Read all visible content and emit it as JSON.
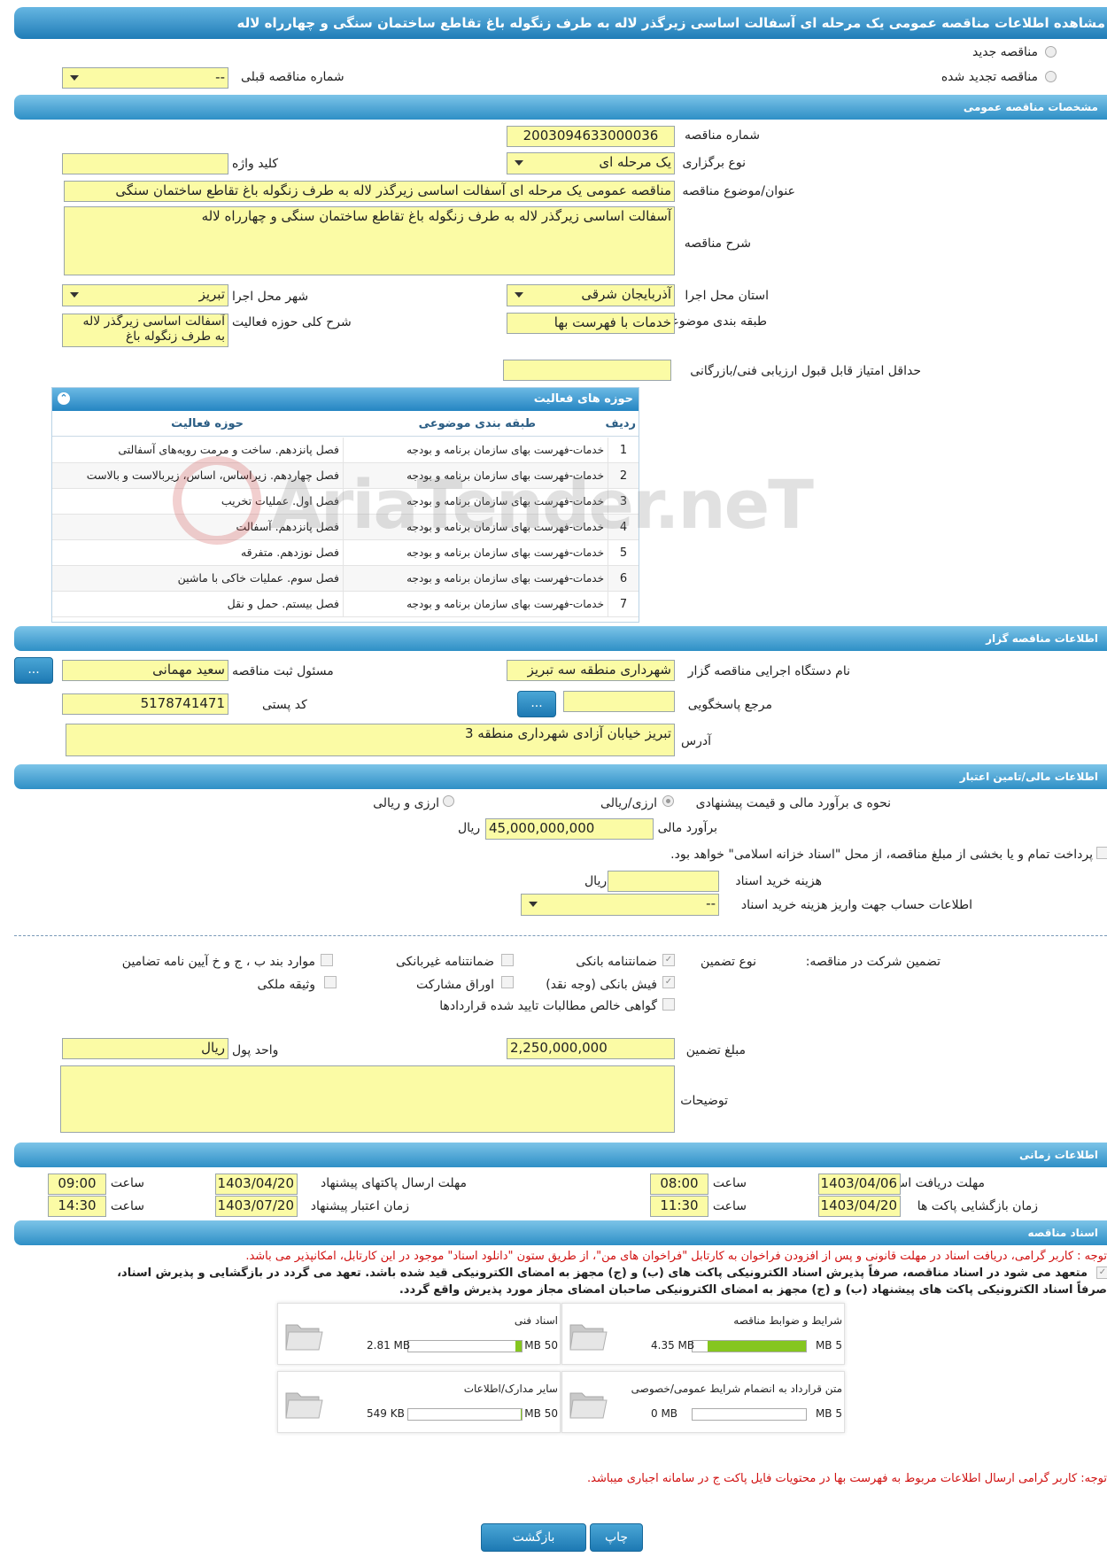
{
  "title": "مشاهده اطلاعات مناقصه عمومی یک مرحله ای آسفالت اساسی زیرگذر لاله به طرف زنگوله باغ تقاطع ساختمان سنگی و چهارراه لاله",
  "top": {
    "new_tender": "مناقصه جدید",
    "renewed_tender": "مناقصه تجدید شده",
    "prev_number_label": "شماره مناقصه قبلی",
    "prev_number_value": "--"
  },
  "general": {
    "header": "مشخصات مناقصه عمومی",
    "number_label": "شماره مناقصه",
    "number_value": "2003094633000036",
    "type_label": "نوع برگزاری",
    "type_value": "یک مرحله ای",
    "keyword_label": "کلید واژه",
    "keyword_value": "",
    "subject_label": "عنوان/موضوع مناقصه",
    "subject_value": "مناقصه عمومی یک مرحله ای آسفالت اساسی زیرگذر لاله به طرف زنگوله باغ تقاطع ساختمان سنگی",
    "desc_label": "شرح مناقصه",
    "desc_value": "آسفالت اساسی زیرگذر لاله به طرف زنگوله باغ تقاطع ساختمان سنگی و چهارراه لاله",
    "province_label": "استان محل اجرا",
    "province_value": "آذربایجان شرقی",
    "city_label": "شهر محل اجرا",
    "city_value": "تبریز",
    "category_label": "طبقه بندی موضوعی",
    "category_value": "خدمات با فهرست بها",
    "scope_label": "شرح کلی حوزه فعالیت",
    "scope_value": "آسفالت اساسی زیرگذر لاله به طرف زنگوله باغ",
    "min_score_label": "حداقل امتیاز قابل قبول ارزیابی فنی/بازرگانی",
    "min_score_value": ""
  },
  "activities": {
    "title": "حوزه های فعالیت",
    "col_row": "ردیف",
    "col_category": "طبقه بندی موضوعی",
    "col_scope": "حوزه فعالیت",
    "rows": [
      {
        "n": "1",
        "category": "خدمات-فهرست بهای سازمان برنامه و بودجه",
        "scope": "فصل پانزدهم. ساخت و مرمت رویه‌های آسفالتی"
      },
      {
        "n": "2",
        "category": "خدمات-فهرست بهای سازمان برنامه و بودجه",
        "scope": "فصل چهاردهم. زیراساس، اساس، زیربالاست  و بالاست"
      },
      {
        "n": "3",
        "category": "خدمات-فهرست بهای سازمان برنامه و بودجه",
        "scope": "فصل اول. عملیات تخریب"
      },
      {
        "n": "4",
        "category": "خدمات-فهرست بهای سازمان برنامه و بودجه",
        "scope": "فصل پانزدهم. آسفالت"
      },
      {
        "n": "5",
        "category": "خدمات-فهرست بهای سازمان برنامه و بودجه",
        "scope": "فصل نوزدهم. متفرقه"
      },
      {
        "n": "6",
        "category": "خدمات-فهرست بهای سازمان برنامه و بودجه",
        "scope": "فصل سوم. عملیات خاکی با ماشین"
      },
      {
        "n": "7",
        "category": "خدمات-فهرست بهای سازمان برنامه و بودجه",
        "scope": "فصل بیستم. حمل و نقل"
      }
    ]
  },
  "organizer": {
    "header": "اطلاعات مناقصه گزار",
    "org_label": "نام دستگاه اجرایی مناقصه گزار",
    "org_value": "شهرداری منطقه سه تبریز",
    "resp_label": "مسئول ثبت مناقصه",
    "resp_value": "سعید مهمانی",
    "ref_label": "مرجع پاسخگویی",
    "ref_value": "",
    "postal_label": "کد پستی",
    "postal_value": "5178741471",
    "address_label": "آدرس",
    "address_value": "تبریز خیابان آزادی شهرداری منطقه 3",
    "more_btn": "..."
  },
  "finance": {
    "header": "اطلاعات مالی/تامین اعتبار",
    "method_label": "نحوه ی برآورد مالی و قیمت پیشنهادی",
    "opt1": "ارزی/ریالی",
    "opt2": "ارزی و ریالی",
    "estimate_label": "برآورد مالی",
    "estimate_value": "45,000,000,000",
    "rial": "ریال",
    "treasury_text": "پرداخت تمام و یا بخشی از مبلغ مناقصه، از محل \"اسناد خزانه اسلامی\" خواهد بود.",
    "doc_cost_label": "هزینه خرید اسناد",
    "doc_cost_value": "",
    "account_label": "اطلاعات حساب جهت واریز هزینه خرید اسناد",
    "account_value": "--"
  },
  "guarantee": {
    "label": "تضمین شرکت در مناقصه:",
    "type_label": "نوع تضمین",
    "bank_guarantee": "ضمانتنامه بانکی",
    "nonbank_guarantee": "ضمانتنامه غیربانکی",
    "clauses": "موارد بند ب ، ج و خ آیین نامه تضامین",
    "cash_receipt": "فیش بانکی (وجه نقد)",
    "bonds": "اوراق مشارکت",
    "property": "وثیقه ملکی",
    "claims": "گواهی خالص مطالبات تایید شده قراردادها",
    "amount_label": "مبلغ تضمین",
    "amount_value": "2,250,000,000",
    "currency_label": "واحد پول",
    "currency_value": "ریال",
    "notes_label": "توضیحات",
    "notes_value": ""
  },
  "timing": {
    "header": "اطلاعات زمانی",
    "receive_label": "مهلت دریافت اسناد",
    "receive_date": "1403/04/06",
    "receive_time": "08:00",
    "send_label": "مهلت ارسال پاکتهای پیشنهاد",
    "send_date": "1403/04/20",
    "send_time": "09:00",
    "open_label": "زمان بازگشایی پاکت ها",
    "open_date": "1403/04/20",
    "open_time": "11:30",
    "valid_label": "زمان اعتبار پیشنهاد",
    "valid_date": "1403/07/20",
    "valid_time": "14:30",
    "time_label": "ساعت"
  },
  "docs": {
    "header": "اسناد مناقصه",
    "note1": "توجه : کاربر گرامی، دریافت اسناد در مهلت قانونی و پس از افزودن فراخوان به کارتابل \"فراخوان های من\"، از طریق ستون \"دانلود اسناد\" موجود در این کارتابل، امکانپذیر می باشد.",
    "pledge1": "متعهد می شود در اسناد مناقصه، صرفاً پذیرش اسناد الکترونیکی پاکت های (ب) و (ج) مجهز به امضای الکترونیکی قید شده باشد. تعهد می گردد در بازگشایی و پذیرش اسناد،",
    "pledge2": "صرفاً اسناد الکترونیکی پاکت های پیشنهاد (ب) و (ج) مجهز به امضای الکترونیکی صاحبان امضای مجاز مورد پذیرش واقع گردد.",
    "cards": [
      {
        "title": "شرایط و ضوابط مناقصه",
        "size": "4.35 MB",
        "max": "5 MB",
        "fill": 0.87
      },
      {
        "title": "اسناد فنی",
        "size": "2.81 MB",
        "max": "50 MB",
        "fill": 0.056
      },
      {
        "title": "متن قرارداد به انضمام شرایط عمومی/خصوصی",
        "size": "0 MB",
        "max": "5 MB",
        "fill": 0
      },
      {
        "title": "سایر مدارک/اطلاعات",
        "size": "549 KB",
        "max": "50 MB",
        "fill": 0.011
      }
    ],
    "note2": "توجه: کاربر گرامی ارسال اطلاعات مربوط به فهرست بها در محتویات فایل پاکت ج در سامانه اجباری میباشد."
  },
  "buttons": {
    "print": "چاپ",
    "back": "بازگشت"
  },
  "watermark": "AriaTender.neT",
  "colors": {
    "field_bg": "#fbfba5",
    "header_blue": "#2e8fc6",
    "bar_green": "#85c61f",
    "note_red": "#d01010"
  }
}
